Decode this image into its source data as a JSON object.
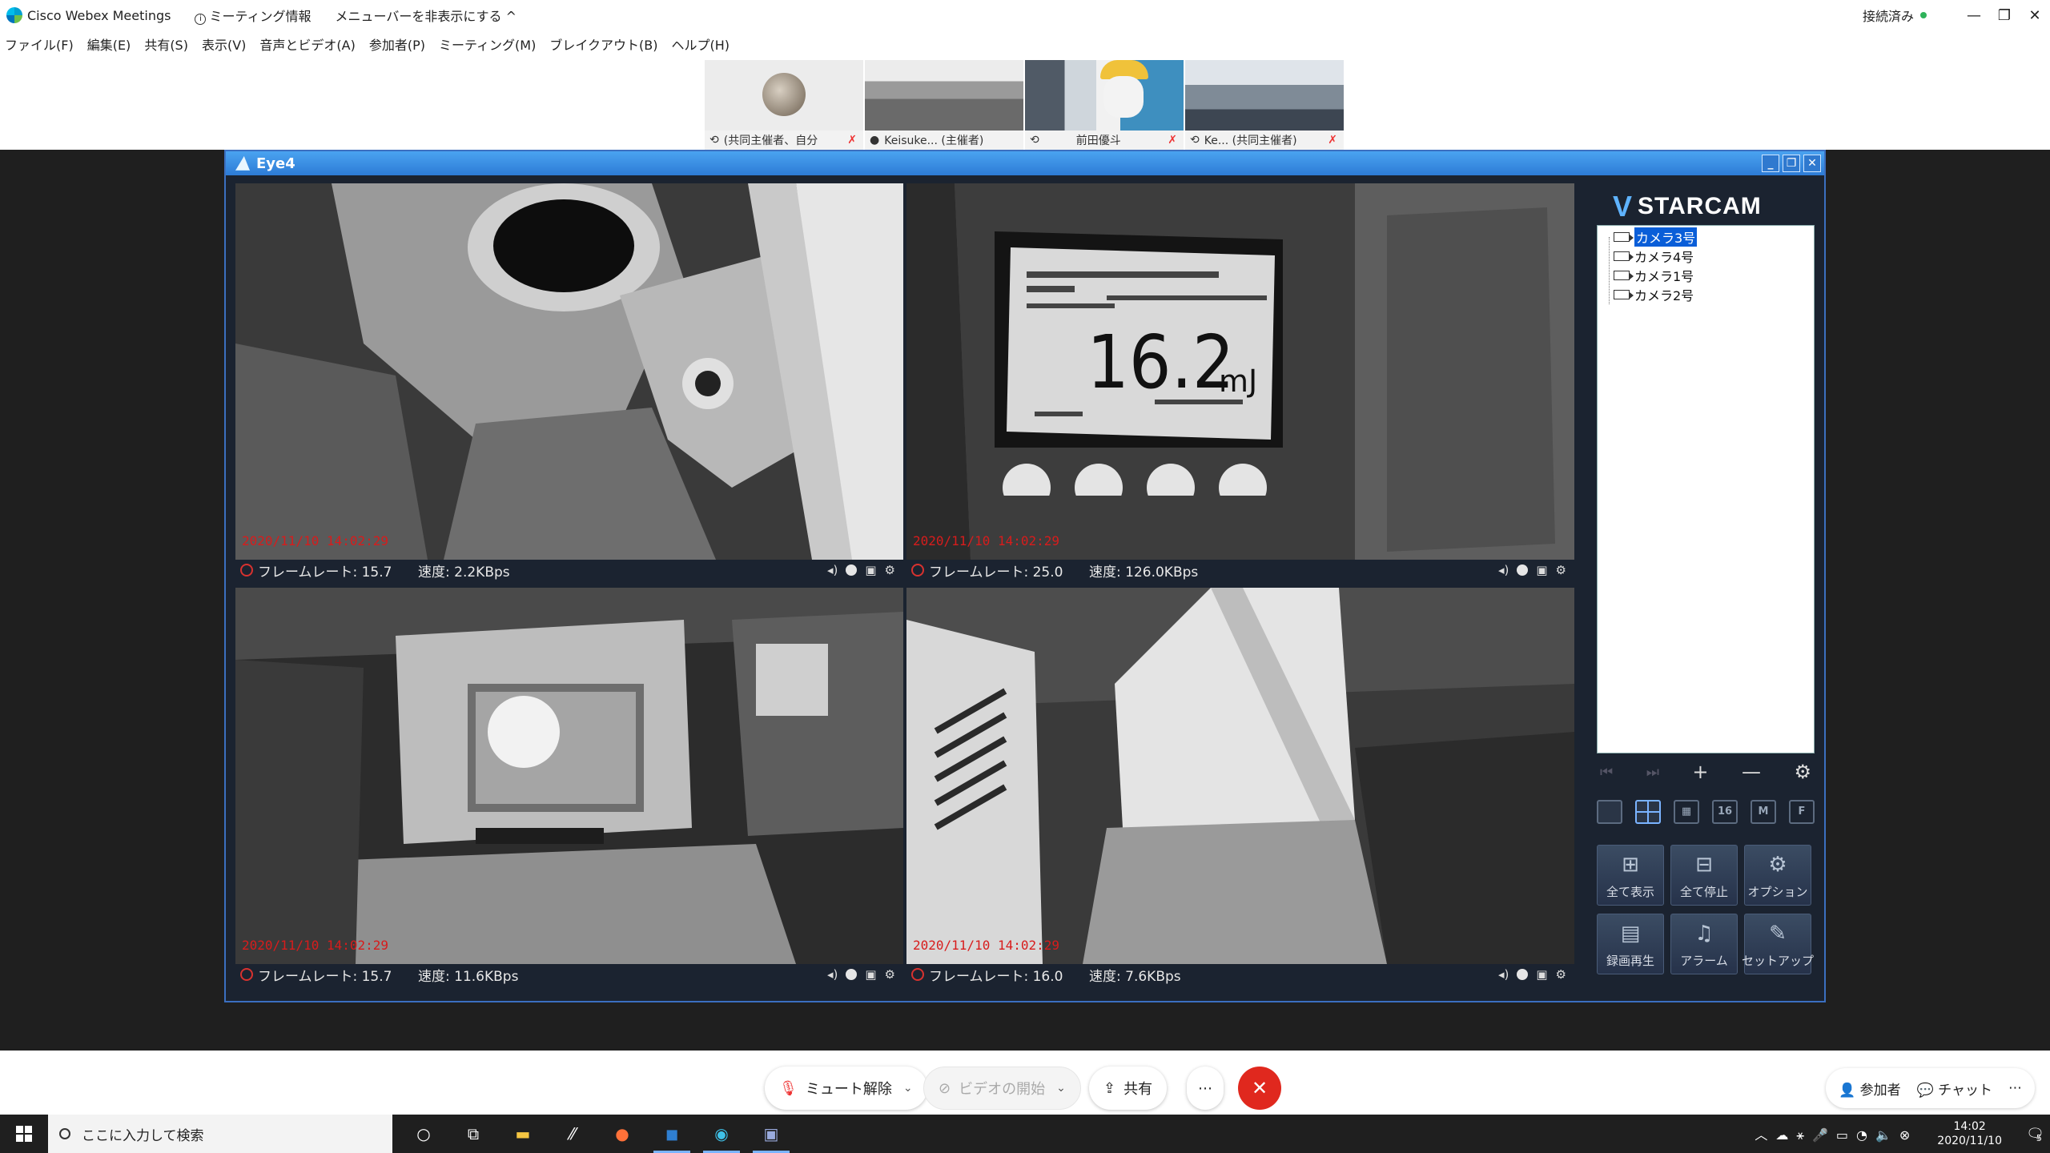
{
  "webex": {
    "app_title": "Cisco Webex Meetings",
    "meeting_info": "ミーティング情報",
    "hide_menu": "メニューバーを非表示にする ^",
    "status": "接続済み",
    "window_controls": [
      "—",
      "❐",
      "✕"
    ],
    "menus": [
      "ファイル(F)",
      "編集(E)",
      "共有(S)",
      "表示(V)",
      "音声とビデオ(A)",
      "参加者(P)",
      "ミーティング(M)",
      "ブレイクアウト(B)",
      "ヘルプ(H)"
    ],
    "participants": [
      {
        "label": "(共同主催者、自分",
        "muted": true
      },
      {
        "label": "Keisuke... (主催者)",
        "muted": false
      },
      {
        "label": "前田優斗",
        "muted": true
      },
      {
        "label": "Ke... (共同主催者)",
        "muted": true
      }
    ],
    "controls": {
      "unmute": "ミュート解除",
      "start_video": "ビデオの開始",
      "share": "共有",
      "more": "⋯",
      "participants": "参加者",
      "chat": "チャット",
      "more_right": "⋯"
    },
    "accent_red": "#e0281e",
    "status_green": "#2fb35a"
  },
  "eye4": {
    "title": "Eye4",
    "brand": "STARCAM",
    "cameras": [
      {
        "timestamp": "2020/11/10 14:02:29",
        "fps": "フレームレート: 15.7",
        "speed": "速度: 2.2KBps"
      },
      {
        "timestamp": "2020/11/10 14:02:29",
        "fps": "フレームレート: 25.0",
        "speed": "速度: 126.0KBps",
        "display_reading": "16.2",
        "display_unit": "mJ"
      },
      {
        "timestamp": "2020/11/10 14:02:29",
        "fps": "フレームレート: 15.7",
        "speed": "速度: 11.6KBps"
      },
      {
        "timestamp": "2020/11/10 14:02:29",
        "fps": "フレームレート: 16.0",
        "speed": "速度: 7.6KBps"
      }
    ],
    "tree": [
      "カメラ3号",
      "カメラ4号",
      "カメラ1号",
      "カメラ2号"
    ],
    "tree_selected": "カメラ3号",
    "nav": {
      "prev": "⏮",
      "next": "⏭",
      "add": "+",
      "remove": "—",
      "settings": "⚙"
    },
    "layouts": [
      "",
      "",
      "",
      "16",
      "M",
      "F"
    ],
    "buttons": [
      "全て表示",
      "全て停止",
      "オプション",
      "録画再生",
      "アラーム",
      "セットアップ"
    ],
    "timestamp_color": "#d81c1c"
  },
  "taskbar": {
    "search_placeholder": "ここに入力して検索",
    "time": "14:02",
    "date": "2020/11/10",
    "notifications": "5"
  }
}
